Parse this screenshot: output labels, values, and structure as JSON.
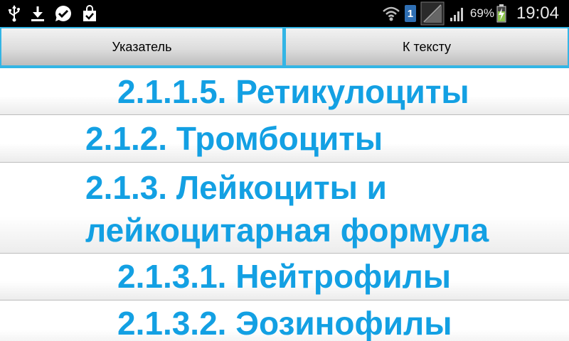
{
  "status_bar": {
    "left_icons": [
      "usb-icon",
      "download-icon",
      "check-bubble-icon",
      "shopping-bag-icon"
    ],
    "notification_badge": "1",
    "battery_percent": "69%",
    "time": "19:04"
  },
  "toolbar": {
    "index_label": "Указатель",
    "to_text_label": "К тексту"
  },
  "toc": {
    "items": [
      {
        "text": "2.1.1.5. Ретикулоциты"
      },
      {
        "text": "2.1.2. Тромбоциты"
      },
      {
        "text": "2.1.3. Лейкоциты и лейкоцитарная формула"
      },
      {
        "text": "2.1.3.1. Нейтрофилы"
      },
      {
        "text": "2.1.3.2. Эозинофилы"
      }
    ]
  },
  "colors": {
    "accent": "#33b5e5",
    "link_text": "#13a0e3",
    "status_bar": "#000000"
  }
}
